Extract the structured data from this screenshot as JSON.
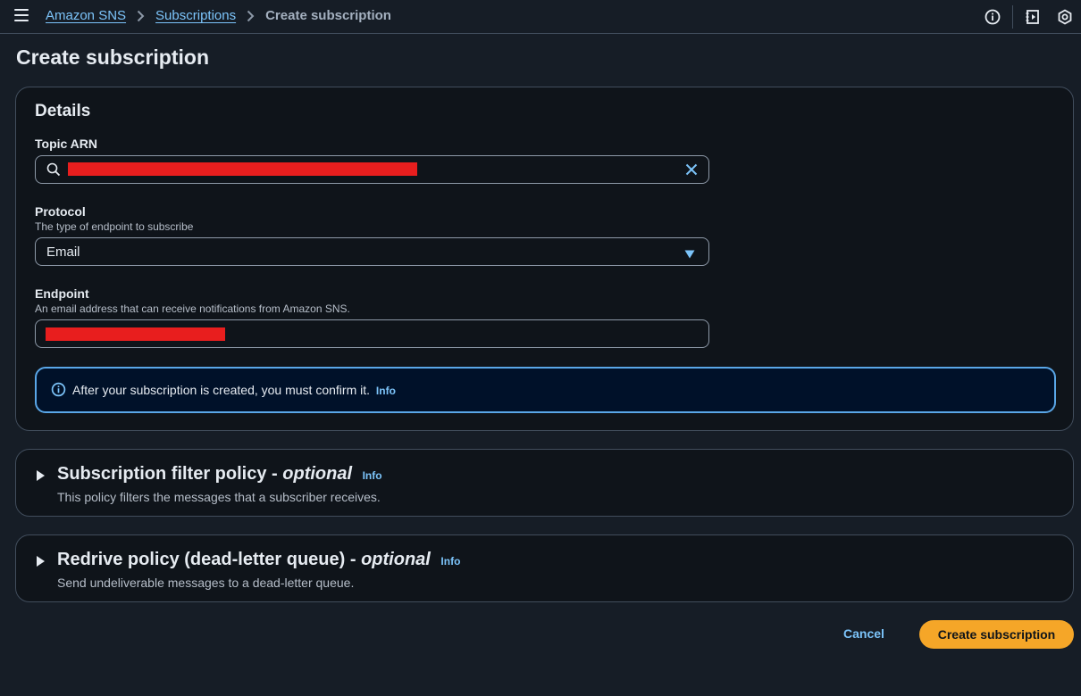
{
  "breadcrumb": {
    "items": [
      "Amazon SNS",
      "Subscriptions"
    ],
    "current": "Create subscription"
  },
  "top_icons": [
    "info-icon",
    "notes-icon",
    "settings-icon"
  ],
  "page": {
    "title": "Create subscription"
  },
  "details": {
    "title": "Details",
    "topic_arn": {
      "label": "Topic ARN",
      "value": "[redacted]"
    },
    "protocol": {
      "label": "Protocol",
      "description": "The type of endpoint to subscribe",
      "value": "Email"
    },
    "endpoint": {
      "label": "Endpoint",
      "description": "An email address that can receive notifications from Amazon SNS.",
      "value": "[redacted]"
    },
    "alert": {
      "text": "After your subscription is created, you must confirm it.",
      "link": "Info"
    }
  },
  "filter_policy": {
    "title": "Subscription filter policy -",
    "optional": "optional",
    "info": "Info",
    "description": "This policy filters the messages that a subscriber receives."
  },
  "redrive_policy": {
    "title": "Redrive policy (dead-letter queue) -",
    "optional": "optional",
    "info": "Info",
    "description": "Send undeliverable messages to a dead-letter queue."
  },
  "actions": {
    "cancel": "Cancel",
    "create": "Create subscription"
  },
  "colors": {
    "accent": "#f5a628",
    "link": "#7cc4fa",
    "redaction": "#e81e1e",
    "alert_border": "#5aa7e8"
  }
}
